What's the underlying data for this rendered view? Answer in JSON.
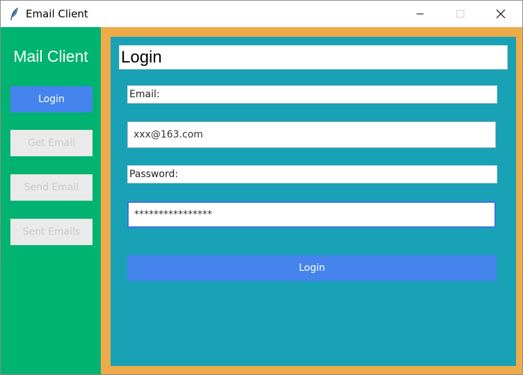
{
  "window": {
    "title": "Email Client",
    "icon": "feather-icon"
  },
  "sidebar": {
    "title": "Mail Client",
    "items": [
      {
        "label": "Login",
        "state": "active"
      },
      {
        "label": "Get Email",
        "state": "disabled"
      },
      {
        "label": "Send Email",
        "state": "disabled"
      },
      {
        "label": "Sent Emails",
        "state": "disabled"
      }
    ]
  },
  "main": {
    "title": "Login",
    "email_label": "Email:",
    "email_value": "xxx@163.com",
    "password_label": "Password:",
    "password_value": "****************",
    "login_button": "Login"
  },
  "colors": {
    "sidebar": "#00b371",
    "frame": "#eeab49",
    "panel": "#19a2b6",
    "button": "#4584ec"
  }
}
